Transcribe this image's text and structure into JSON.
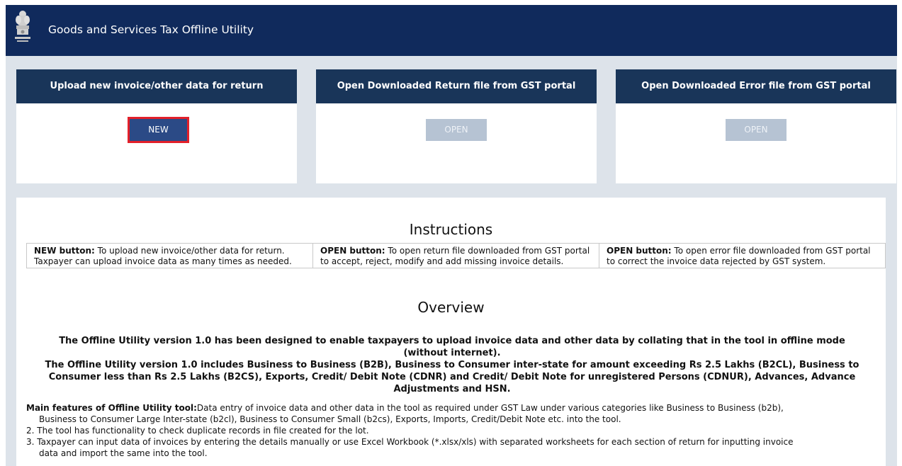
{
  "header": {
    "title": "Goods and Services Tax Offline Utility",
    "emblem_icon": "national-emblem-icon"
  },
  "cards": [
    {
      "heading": "Upload new invoice/other data for return",
      "button": "NEW"
    },
    {
      "heading": "Open Downloaded Return file from GST portal",
      "button": "OPEN"
    },
    {
      "heading": "Open Downloaded Error file from GST portal",
      "button": "OPEN"
    }
  ],
  "instructions": {
    "title": "Instructions",
    "cols": [
      {
        "label": "NEW button:",
        "text": " To upload new invoice/other data for return. Taxpayer can upload invoice data as many times as needed."
      },
      {
        "label": "OPEN button:",
        "text": " To open return file downloaded from GST portal to accept, reject, modify and add missing invoice details."
      },
      {
        "label": "OPEN button:",
        "text": " To open error file downloaded from GST portal to correct the invoice data rejected by GST system."
      }
    ]
  },
  "overview": {
    "title": "Overview",
    "para1": "The Offline Utility version 1.0 has been designed to enable taxpayers to upload invoice data and other data by collating that in the tool in offline mode (without internet).",
    "para2": "The Offline Utility version 1.0 includes Business to Business (B2B), Business to Consumer inter-state for amount exceeding Rs 2.5 Lakhs (B2CL), Business to Consumer less than Rs 2.5 Lakhs (B2CS), Exports, Credit/ Debit Note (CDNR) and Credit/ Debit Note for unregistered Persons (CDNUR), Advances, Advance Adjustments and HSN.",
    "features_label": "Main features of Offline Utility tool:",
    "feature1_a": "Data entry of invoice data and other data in the tool as required under GST Law under various categories like Business to Business (b2b),",
    "feature1_b": "Business to Consumer Large Inter-state (b2cl), Business to Consumer Small (b2cs), Exports, Imports, Credit/Debit Note etc. into the tool.",
    "feature2": "2. The tool has functionality to check duplicate records in file created for the lot.",
    "feature3_a": "3. Taxpayer can input data of invoices by entering the details manually or use Excel Workbook (*.xlsx/xls) with separated worksheets for each section of return for inputting invoice",
    "feature3_b": "data and import the same into the tool."
  },
  "colors": {
    "header_bg": "#102a5c",
    "card_head_bg": "#193559",
    "new_button_bg": "#2b4a86",
    "highlight_border": "#e3202a",
    "disabled_button_bg": "#b6c3d3",
    "page_bg": "#dde3ea"
  }
}
